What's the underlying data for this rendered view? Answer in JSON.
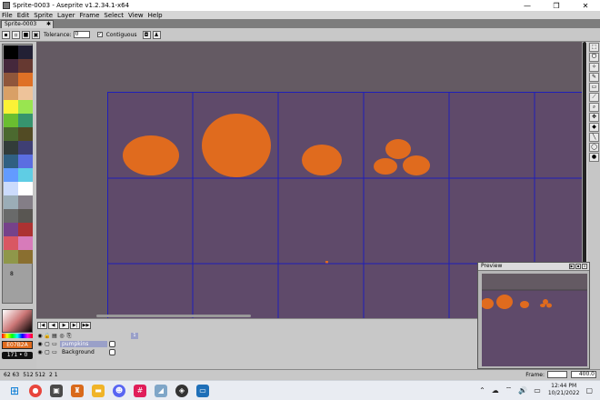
{
  "window": {
    "title": "Sprite-0003 - Aseprite v1.2.34.1-x64",
    "minimize": "—",
    "maximize": "❐",
    "close": "✕"
  },
  "menu": [
    "File",
    "Edit",
    "Sprite",
    "Layer",
    "Frame",
    "Select",
    "View",
    "Help"
  ],
  "tab": {
    "label": "Sprite-0003",
    "close": "✱"
  },
  "context_bar": {
    "tolerance_label": "Tolerance:",
    "tolerance_value": "0",
    "contiguous_label": "Contiguous"
  },
  "colors": {
    "accent_orange": "#e06b1e",
    "canvas_bg": "#5f4a6a",
    "grid": "#1f1fb8",
    "workspace": "#645a63"
  },
  "palette_marker": "8",
  "color_panel": {
    "fgbg_label": "E07B2A",
    "coord_label": "171 • 0"
  },
  "timeline": {
    "layers": [
      {
        "name": "pumpkins",
        "frame": "1"
      },
      {
        "name": "Background"
      }
    ]
  },
  "preview": {
    "label": "Preview"
  },
  "status": {
    "cursor": "62 63",
    "size": "512 512",
    "frame_info": "2 1",
    "frame_label": "Frame:",
    "zoom": "400.0"
  },
  "taskbar": {
    "time": "12:44 PM",
    "date": "10/21/2022"
  }
}
